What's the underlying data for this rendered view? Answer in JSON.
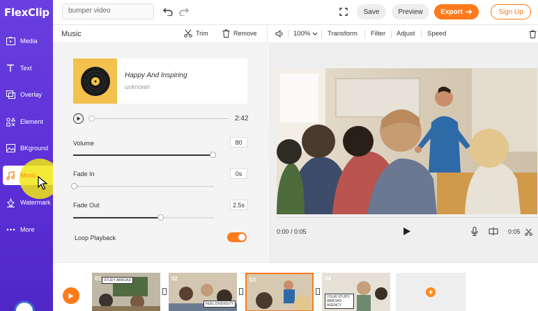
{
  "app": {
    "logo": "FlexClip"
  },
  "sidebar": {
    "items": [
      {
        "label": "Media",
        "icon": "media-icon"
      },
      {
        "label": "Text",
        "icon": "text-icon"
      },
      {
        "label": "Overlay",
        "icon": "overlay-icon"
      },
      {
        "label": "Element",
        "icon": "element-icon"
      },
      {
        "label": "BKground",
        "icon": "background-icon"
      },
      {
        "label": "Music",
        "icon": "music-icon",
        "active": true
      },
      {
        "label": "Watermark",
        "icon": "watermark-icon"
      },
      {
        "label": "More",
        "icon": "more-icon"
      }
    ]
  },
  "topbar": {
    "search_value": "bumper video",
    "save_label": "Save",
    "preview_label": "Preview",
    "export_label": "Export",
    "signup_label": "Sign Up"
  },
  "music_panel": {
    "title": "Music",
    "trim_label": "Trim",
    "remove_label": "Remove",
    "track_name": "Happy And Inspiring",
    "track_artist": "unknown",
    "duration": "2:42",
    "volume_label": "Volume",
    "volume_value": "80",
    "fade_in_label": "Fade In",
    "fade_in_value": "0s",
    "fade_out_label": "Fade Out",
    "fade_out_value": "2.5s",
    "loop_label": "Loop Playback",
    "loop_on": true
  },
  "edit_bar": {
    "zoom": "100%",
    "transform_label": "Transform",
    "filter_label": "Filter",
    "adjust_label": "Adjust",
    "speed_label": "Speed"
  },
  "player": {
    "current_time": "0:00 / 0:05",
    "duration": "0:05"
  },
  "timeline": {
    "clips": [
      {
        "num": "01",
        "tag": "STUDY ABROAD"
      },
      {
        "num": "02",
        "tag": "FEEL DIVERSITY"
      },
      {
        "num": "03",
        "tag": ""
      },
      {
        "num": "04",
        "tag": "YOUR STUDY ABROAD AGENCY"
      }
    ],
    "add_label": "+"
  },
  "colors": {
    "accent": "#ff7a1a",
    "sidebar": "#5b2fd6",
    "highlight": "#f0e614"
  }
}
